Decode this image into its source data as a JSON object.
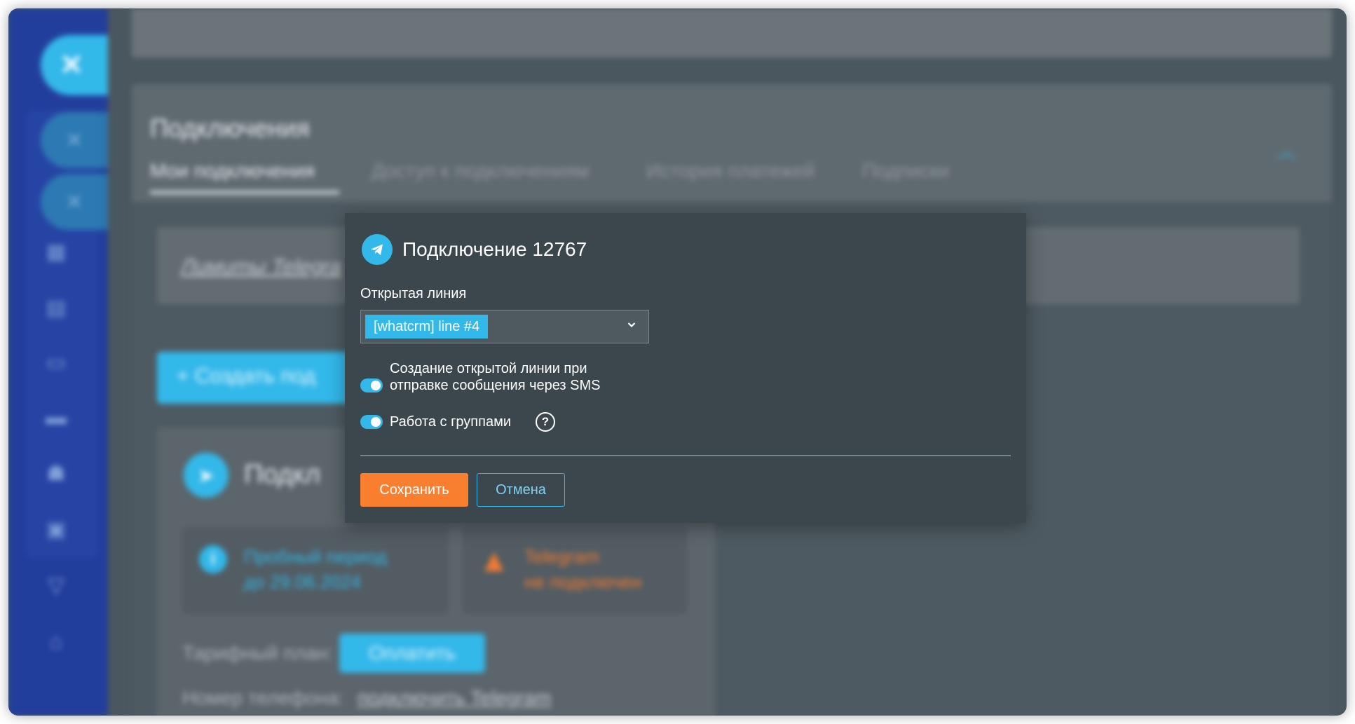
{
  "background": {
    "panel_title": "Подключения",
    "tabs": [
      {
        "label": "Мои подключения",
        "active": true
      },
      {
        "label": "Доступ к подключениям",
        "active": false
      },
      {
        "label": "История платежей",
        "active": false
      },
      {
        "label": "Подписки",
        "active": false
      }
    ],
    "limits_link": "Лимиты Telegra",
    "create_button": "Создать под",
    "card_title": "Подкл",
    "trial_text_line1": "Пробный период",
    "trial_text_line2": "до 29.06.2024",
    "warning_text_line1": "Telegram",
    "warning_text_line2": "не подключен",
    "tariff_label": "Тарифный план:",
    "pay_button": "Оплатить",
    "phone_label": "Номер телефона:",
    "phone_link": "подключить Telegram"
  },
  "modal": {
    "title": "Подключение 12767",
    "open_line_label": "Открытая линия",
    "open_line_value": "[whatcrm] line #4",
    "toggle_sms_line1": "Создание открытой линии при",
    "toggle_sms_line2": "отправке сообщения через SMS",
    "toggle_sms_on": true,
    "toggle_groups_label": "Работа с группами",
    "toggle_groups_on": true,
    "help_symbol": "?",
    "save_label": "Сохранить",
    "cancel_label": "Отмена"
  },
  "colors": {
    "accent": "#33b8ea",
    "primary_button": "#f97f2f",
    "sidebar": "#223e9c",
    "modal_bg": "#3c474d",
    "warning": "#f07a33"
  },
  "icons": {
    "sidebar_close": "close-icon",
    "modal": "telegram-icon",
    "select": "chevron-down-icon",
    "help": "help-icon"
  }
}
